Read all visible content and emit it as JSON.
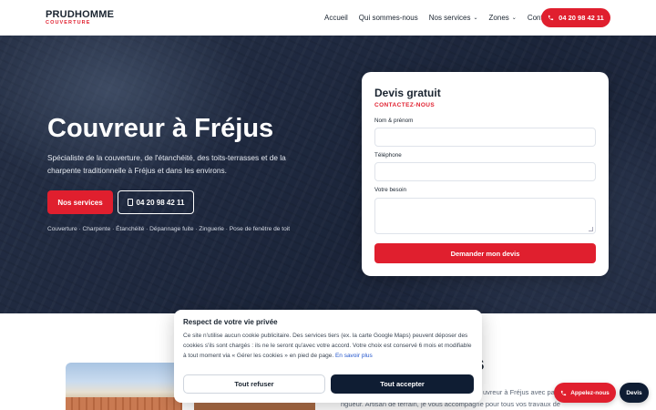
{
  "header": {
    "logo_main": "PRUDHOMME",
    "logo_sub": "COUVERTURE",
    "nav": [
      {
        "label": "Accueil"
      },
      {
        "label": "Qui sommes-nous"
      },
      {
        "label": "Nos services"
      },
      {
        "label": "Zones"
      },
      {
        "label": "Contact"
      }
    ],
    "phone": "04 20 98 42 11"
  },
  "hero": {
    "title": "Couvreur à Fréjus",
    "description": "Spécialiste de la couverture, de l'étanchéité, des toits-terrasses et de la charpente traditionnelle à Fréjus et dans les environs.",
    "btn_services": "Nos services",
    "btn_phone": "04 20 98 42 11",
    "tags": "Couverture · Charpente · Étanchéité · Dépannage fuite · Zinguerie · Pose de fenêtre de toit"
  },
  "quote_form": {
    "title": "Devis gratuit",
    "subtitle": "CONTACTEZ-NOUS",
    "label_name": "Nom & prénom",
    "label_phone": "Téléphone",
    "label_need": "Votre besoin",
    "submit": "Demander mon devis"
  },
  "section": {
    "title_fragment": "s",
    "text_line1": "uvreur à Fréjus avec pa",
    "text_line2": "rigueur. Artisan de terrain, je vous accompagne pour tous vos travaux de"
  },
  "cookie": {
    "title": "Respect de votre vie privée",
    "text": "Ce site n'utilise aucun cookie publicitaire. Des services tiers (ex. la carte Google Maps) peuvent déposer des cookies s'ils sont chargés : ils ne le seront qu'avec votre accord. Votre choix est conservé 6 mois et modifiable à tout moment via « Gérer les cookies » en pied de page.",
    "link": "En savoir plus",
    "refuse": "Tout refuser",
    "accept": "Tout accepter"
  },
  "floating": {
    "call": "Appelez-nous",
    "devis": "Devis"
  },
  "colors": {
    "accent": "#e01f2e",
    "navy": "#0f1d33",
    "text": "#1a2430"
  },
  "icons": {
    "phone": "phone-icon",
    "chevron": "chevron-down-icon"
  }
}
